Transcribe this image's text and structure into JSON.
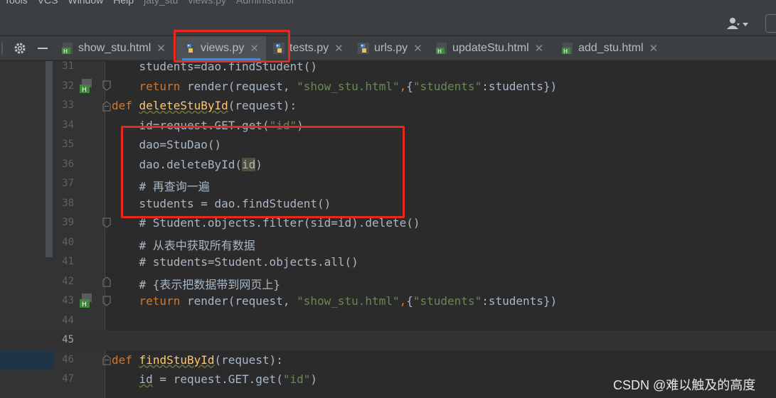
{
  "menubar": {
    "items": [
      "Tools",
      "VCS",
      "Window",
      "Help"
    ],
    "project": "jaty_stu",
    "file": "views.py",
    "user": "Administrator"
  },
  "tabs": [
    {
      "label": "show_stu.html",
      "type": "html",
      "active": false
    },
    {
      "label": "views.py",
      "type": "python",
      "active": true
    },
    {
      "label": "tests.py",
      "type": "python",
      "active": false
    },
    {
      "label": "urls.py",
      "type": "python",
      "active": false
    },
    {
      "label": "updateStu.html",
      "type": "html",
      "active": false
    },
    {
      "label": "add_stu.html",
      "type": "html",
      "active": false
    }
  ],
  "code_lines": [
    {
      "num": "31",
      "text": "    students=dao.findStudent()"
    },
    {
      "num": "32",
      "text": "    return render(request, \"show_stu.html\",{\"students\":students})"
    },
    {
      "num": "33",
      "text": "def deleteStuById(request):"
    },
    {
      "num": "34",
      "text": "    id=request.GET.get(\"id\")"
    },
    {
      "num": "35",
      "text": "    dao=StuDao()"
    },
    {
      "num": "36",
      "text": "    dao.deleteById(id)"
    },
    {
      "num": "37",
      "text": "    # 再查询一遍"
    },
    {
      "num": "38",
      "text": "    students = dao.findStudent()"
    },
    {
      "num": "39",
      "text": "    # Student.objects.filter(sid=id).delete()"
    },
    {
      "num": "40",
      "text": "    # 从表中获取所有数据"
    },
    {
      "num": "41",
      "text": "    # students=Student.objects.all()"
    },
    {
      "num": "42",
      "text": "    # {表示把数据带到网页上}"
    },
    {
      "num": "43",
      "text": "    return render(request, \"show_stu.html\",{\"students\":students})"
    },
    {
      "num": "44",
      "text": ""
    },
    {
      "num": "45",
      "text": ""
    },
    {
      "num": "46",
      "text": "def findStuById(request):"
    },
    {
      "num": "47",
      "text": "    id = request.GET.get(\"id\")"
    }
  ],
  "watermark": "CSDN @难以触及的高度",
  "colors": {
    "editor_bg": "#2b2b2b",
    "keyword": "#cc7832",
    "function": "#ffc66d",
    "string": "#6a8759",
    "comment": "#808080",
    "annotation_box": "#e8281e",
    "tab_underline": "#4a88c7"
  },
  "icons": {
    "toolbar": [
      "user-icon",
      "dropdown-icon"
    ],
    "tabbar": [
      "gear-icon",
      "minimize-icon"
    ],
    "file_types": {
      "html": "html-file-icon",
      "python": "python-file-icon"
    },
    "gutter": [
      "fold-icon",
      "html-template-marker-icon"
    ]
  }
}
